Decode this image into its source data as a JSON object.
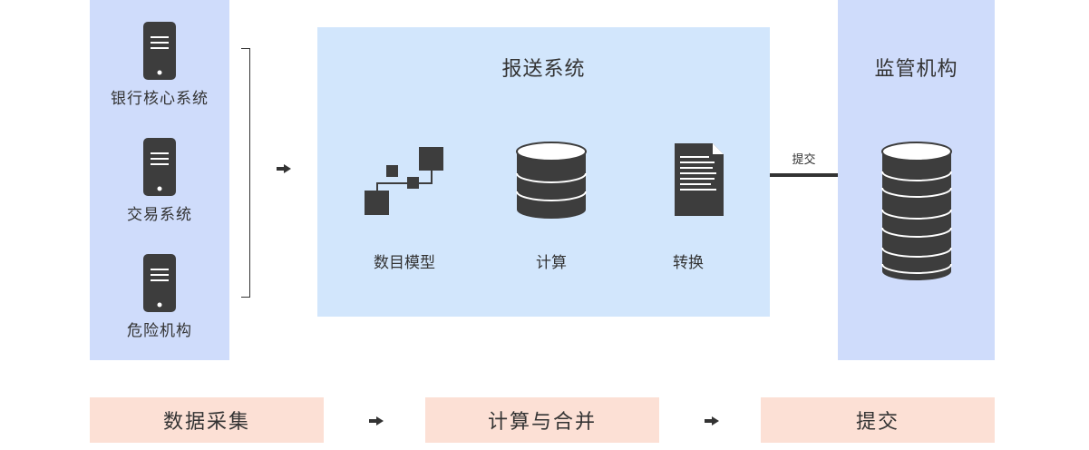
{
  "sources": [
    {
      "label": "银行核心系统",
      "icon": "phone-icon"
    },
    {
      "label": "交易系统",
      "icon": "phone-icon"
    },
    {
      "label": "危险机构",
      "icon": "phone-icon"
    }
  ],
  "reporting_system": {
    "title": "报送系统",
    "items": [
      {
        "label": "数目模型",
        "icon": "flowchart-icon"
      },
      {
        "label": "计算",
        "icon": "database-icon"
      },
      {
        "label": "转换",
        "icon": "document-icon"
      }
    ]
  },
  "link_label": "提交",
  "regulator": {
    "title": "监管机构",
    "icon": "database-icon"
  },
  "steps": [
    {
      "label": "数据采集"
    },
    {
      "label": "计算与合并"
    },
    {
      "label": "提交"
    }
  ],
  "colors": {
    "source_panel": "#cfdcfb",
    "system_panel": "#d2e6fc",
    "step_box": "#fce0d5",
    "icon": "#3d3d3d"
  }
}
